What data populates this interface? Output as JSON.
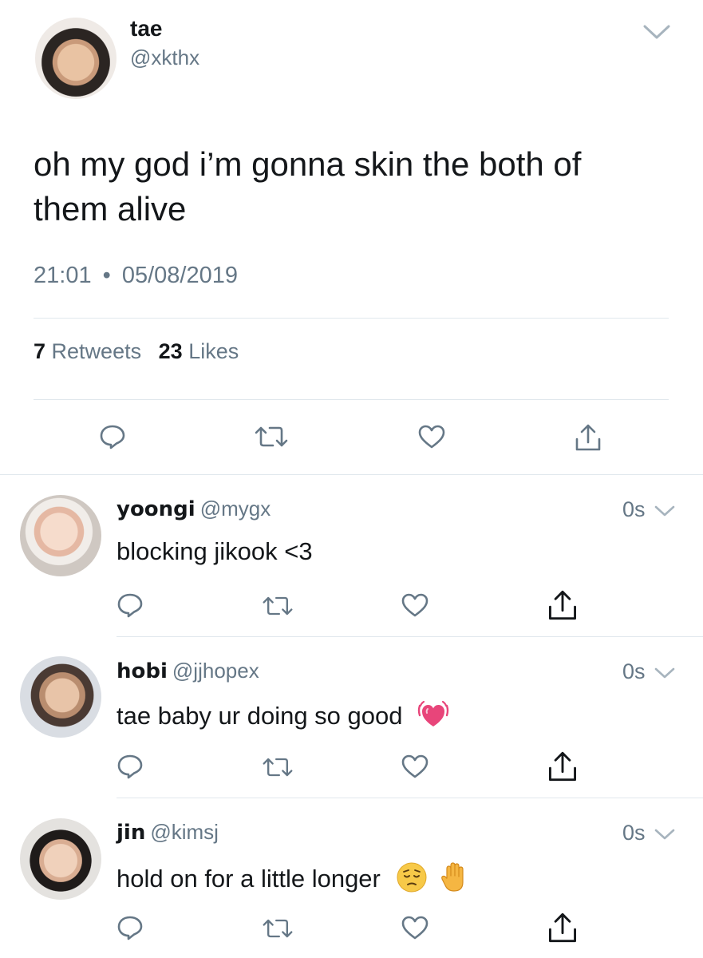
{
  "tweet": {
    "author_name": "tae",
    "author_handle": "@xkthx",
    "text": "oh my god i’m gonna skin the both of them alive",
    "time": "21:01",
    "separator": "•",
    "date": "05/08/2019",
    "retweets_count": "7",
    "retweets_label": "Retweets",
    "likes_count": "23",
    "likes_label": "Likes"
  },
  "replies": [
    {
      "name": "yoongi",
      "handle": "@mygx",
      "time": "0s",
      "text": "blocking jikook <3",
      "emoji": []
    },
    {
      "name": "hobi",
      "handle": "@jjhopex",
      "time": "0s",
      "text": "tae baby ur doing so good",
      "emoji": [
        "vibrating-heart"
      ]
    },
    {
      "name": "jin",
      "handle": "@kimsj",
      "time": "0s",
      "text": "hold on for a little longer",
      "emoji": [
        "pensive-face",
        "raised-hand"
      ]
    }
  ],
  "icons": {
    "reply": "speech-bubble-icon",
    "retweet": "retweet-arrows-icon",
    "like": "heart-outline-icon",
    "share": "share-upload-icon",
    "more": "chevron-down-icon"
  },
  "colors": {
    "text": "#14171a",
    "secondary": "#657786",
    "divider": "#e1e8ed",
    "icon": "#657786"
  }
}
